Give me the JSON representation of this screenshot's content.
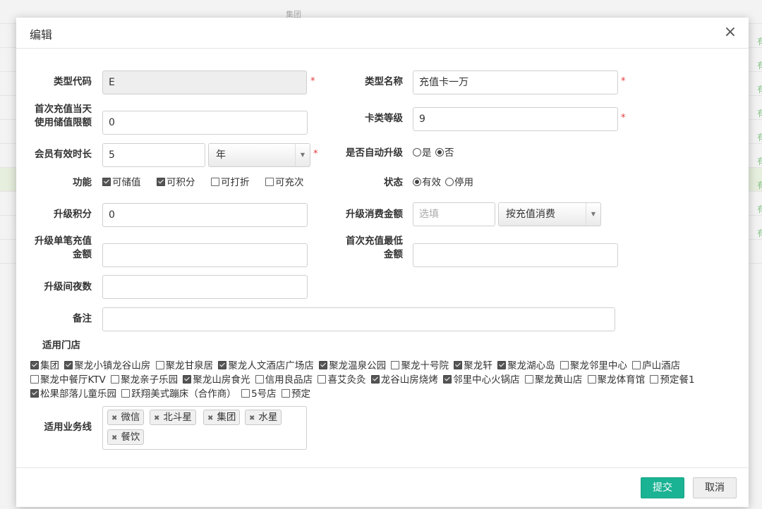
{
  "background": {
    "cell_text": "集团",
    "status_glyph": "有"
  },
  "modal": {
    "title": "编辑",
    "close": "×",
    "required_mark": "*"
  },
  "form": {
    "type_code": {
      "label": "类型代码",
      "value": "E"
    },
    "type_name": {
      "label": "类型名称",
      "value": "充值卡一万"
    },
    "first_recharge_limit": {
      "label_line1": "首次充值当天",
      "label_line2": "使用储值限额",
      "value": "0"
    },
    "card_level": {
      "label": "卡类等级",
      "value": "9"
    },
    "member_validity": {
      "label": "会员有效时长",
      "value": "5",
      "unit": "年"
    },
    "auto_upgrade": {
      "label": "是否自动升级",
      "options": [
        "是",
        "否"
      ],
      "selected": "否"
    },
    "features": {
      "label": "功能",
      "options": [
        {
          "label": "可储值",
          "checked": true
        },
        {
          "label": "可积分",
          "checked": true
        },
        {
          "label": "可打折",
          "checked": false
        },
        {
          "label": "可充次",
          "checked": false
        }
      ]
    },
    "status": {
      "label": "状态",
      "options": [
        "有效",
        "停用"
      ],
      "selected": "有效"
    },
    "upgrade_points": {
      "label": "升级积分",
      "value": "0"
    },
    "upgrade_spend": {
      "label": "升级消费金额",
      "placeholder": "选填",
      "mode": "按充值消费"
    },
    "upgrade_single_recharge": {
      "label_line1": "升级单笔充值",
      "label_line2": "金额",
      "value": ""
    },
    "first_recharge_min": {
      "label_line1": "首次充值最低",
      "label_line2": "金额",
      "value": ""
    },
    "upgrade_nights": {
      "label": "升级间夜数",
      "value": ""
    },
    "remark": {
      "label": "备注",
      "value": ""
    },
    "stores": {
      "label": "适用门店",
      "items": [
        {
          "name": "集团",
          "checked": true
        },
        {
          "name": "聚龙小镇龙谷山房",
          "checked": true
        },
        {
          "name": "聚龙甘泉居",
          "checked": false
        },
        {
          "name": "聚龙人文酒店广场店",
          "checked": true
        },
        {
          "name": "聚龙温泉公园",
          "checked": true
        },
        {
          "name": "聚龙十号院",
          "checked": false
        },
        {
          "name": "聚龙轩",
          "checked": true
        },
        {
          "name": "聚龙湖心岛",
          "checked": true
        },
        {
          "name": "聚龙邻里中心",
          "checked": false
        },
        {
          "name": "庐山酒店",
          "checked": false
        },
        {
          "name": "聚龙中餐厅KTV",
          "checked": false
        },
        {
          "name": "聚龙亲子乐园",
          "checked": false
        },
        {
          "name": "聚龙山房食光",
          "checked": true
        },
        {
          "name": "信用良品店",
          "checked": false
        },
        {
          "name": "喜艾灸灸",
          "checked": false
        },
        {
          "name": "龙谷山房烧烤",
          "checked": true
        },
        {
          "name": "邻里中心火锅店",
          "checked": true
        },
        {
          "name": "聚龙黄山店",
          "checked": false
        },
        {
          "name": "聚龙体育馆",
          "checked": false
        },
        {
          "name": "预定餐1",
          "checked": false
        },
        {
          "name": "松果部落儿童乐园",
          "checked": true
        },
        {
          "name": "跃翔美式蹦床（合作商）",
          "checked": false
        },
        {
          "name": "5号店",
          "checked": false
        },
        {
          "name": "预定",
          "checked": false
        }
      ]
    },
    "business_lines": {
      "label": "适用业务线",
      "tags": [
        "微信",
        "北斗星",
        "集团",
        "水星",
        "餐饮"
      ]
    }
  },
  "footer": {
    "submit": "提交",
    "cancel": "取消"
  },
  "colors": {
    "primary": "#1ab394",
    "required": "#e4393c"
  }
}
